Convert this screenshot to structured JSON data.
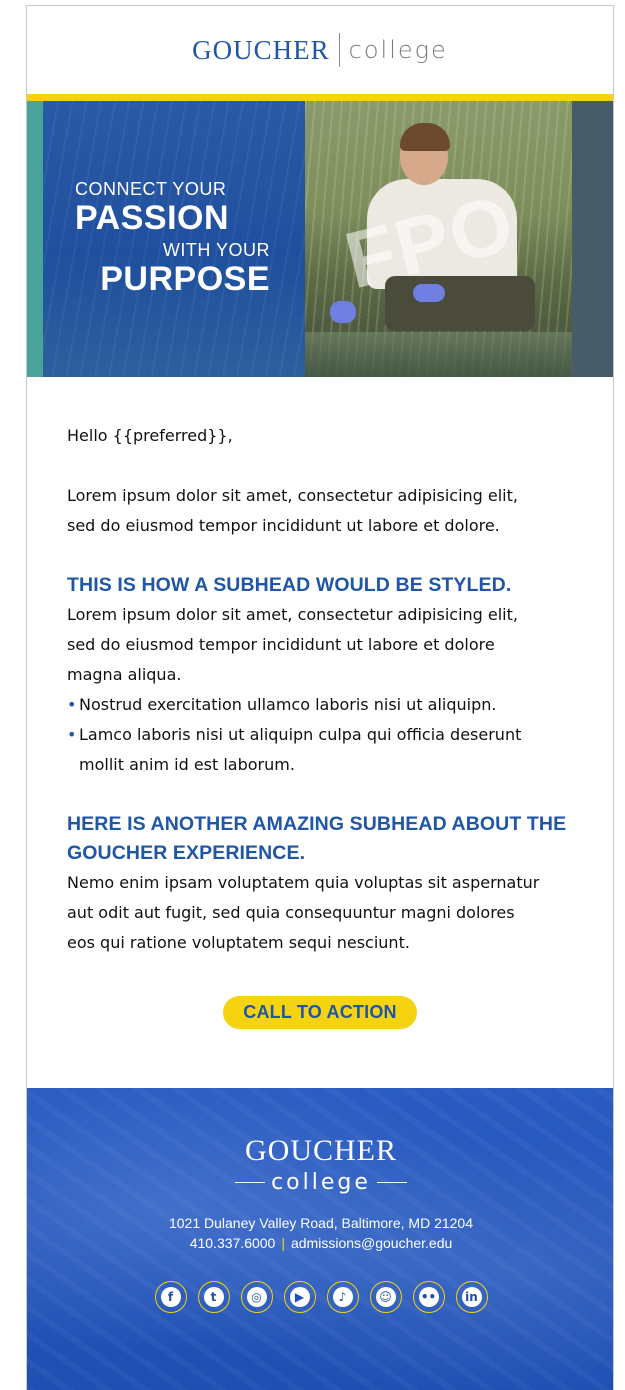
{
  "header": {
    "logo_goucher": "GOUCHER",
    "logo_college": "college"
  },
  "hero": {
    "line1": "CONNECT YOUR",
    "line2": "PASSION",
    "line3": "WITH YOUR",
    "line4": "PURPOSE",
    "watermark": "FPO"
  },
  "body": {
    "greeting": "Hello {{preferred}},",
    "intro": [
      "Lorem ipsum dolor sit amet, consectetur adipisicing elit,",
      "sed do eiusmod tempor incididunt ut labore et dolore."
    ],
    "section1": {
      "subhead": "THIS IS HOW A SUBHEAD WOULD BE STYLED.",
      "para": [
        "Lorem ipsum dolor sit amet, consectetur adipisicing elit,",
        "sed do eiusmod tempor incididunt ut labore et dolore",
        "magna aliqua."
      ],
      "bullets": [
        [
          "Nostrud exercitation ullamco laboris nisi ut aliquipn."
        ],
        [
          "Lamco laboris nisi ut aliquipn culpa qui officia deserunt",
          "mollit anim id est laborum."
        ]
      ]
    },
    "section2": {
      "subhead": [
        "HERE IS ANOTHER AMAZING SUBHEAD ABOUT THE",
        "GOUCHER EXPERIENCE."
      ],
      "para": [
        "Nemo enim ipsam voluptatem quia voluptas sit aspernatur",
        "aut odit aut fugit, sed quia consequuntur magni dolores",
        "eos qui ratione voluptatem sequi nesciunt."
      ]
    },
    "cta_label": "CALL TO ACTION"
  },
  "footer": {
    "logo_goucher": "GOUCHER",
    "logo_college": "college",
    "address": "1021 Dulaney Valley Road, Baltimore, MD 21204",
    "phone": "410.337.6000",
    "separator": "|",
    "email": "admissions@goucher.edu",
    "socials": [
      {
        "name": "facebook-icon",
        "glyph": "f"
      },
      {
        "name": "twitter-icon",
        "glyph": "t"
      },
      {
        "name": "instagram-icon",
        "glyph": "◎"
      },
      {
        "name": "youtube-icon",
        "glyph": "▶"
      },
      {
        "name": "tiktok-icon",
        "glyph": "♪"
      },
      {
        "name": "snapchat-icon",
        "glyph": "☺"
      },
      {
        "name": "flickr-icon",
        "glyph": "••"
      },
      {
        "name": "linkedin-icon",
        "glyph": "in"
      }
    ]
  },
  "colors": {
    "brand_blue": "#1f56a6",
    "brand_yellow": "#f5d40f",
    "footer_blue": "#1f4fb3",
    "hero_teal": "#4aa39a",
    "hero_slate": "#475b68"
  }
}
